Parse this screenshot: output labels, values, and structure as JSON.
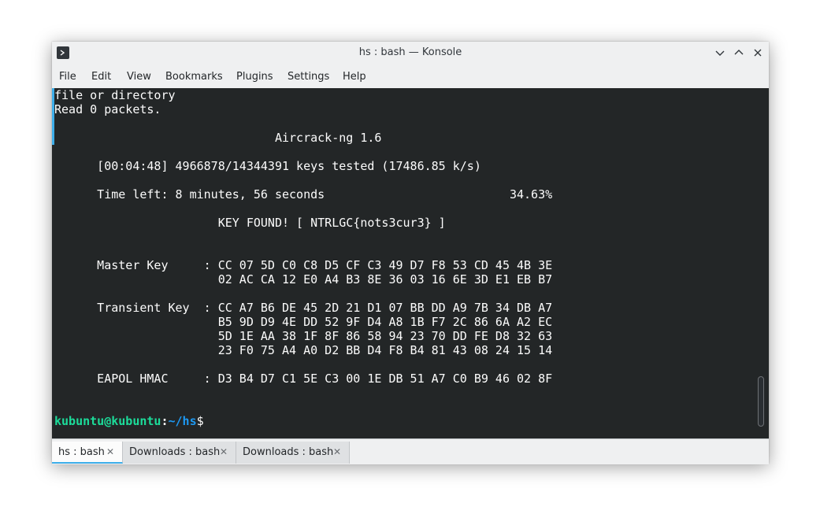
{
  "window": {
    "title": "hs : bash — Konsole"
  },
  "menu": [
    "File",
    "Edit",
    "View",
    "Bookmarks",
    "Plugins",
    "Settings",
    "Help"
  ],
  "terminal": {
    "lines": [
      "file or directory",
      "Read 0 packets.",
      "",
      "                               Aircrack-ng 1.6",
      "",
      "      [00:04:48] 4966878/14344391 keys tested (17486.85 k/s)",
      "",
      "      Time left: 8 minutes, 56 seconds                          34.63%",
      "",
      "                       KEY FOUND! [ NTRLGC{nots3cur3} ]",
      "",
      "",
      "      Master Key     : CC 07 5D C0 C8 D5 CF C3 49 D7 F8 53 CD 45 4B 3E",
      "                       02 AC CA 12 E0 A4 B3 8E 36 03 16 6E 3D E1 EB B7",
      "",
      "      Transient Key  : CC A7 B6 DE 45 2D 21 D1 07 BB DD A9 7B 34 DB A7",
      "                       B5 9D D9 4E DD 52 9F D4 A8 1B F7 2C 86 6A A2 EC",
      "                       5D 1E AA 38 1F 8F 86 58 94 23 70 DD FE D8 32 63",
      "                       23 F0 75 A4 A0 D2 BB D4 F8 B4 81 43 08 24 15 14",
      "",
      "      EAPOL HMAC     : D3 B4 D7 C1 5E C3 00 1E DB 51 A7 C0 B9 46 02 8F"
    ],
    "prompt": {
      "user_host": "kubuntu@kubuntu",
      "colon": ":",
      "path": "~/hs",
      "symbol": "$"
    }
  },
  "tabs": [
    {
      "label": "hs : bash",
      "active": true
    },
    {
      "label": "Downloads : bash",
      "active": false
    },
    {
      "label": "Downloads : bash",
      "active": false
    }
  ],
  "colors": {
    "terminal_bg": "#232627",
    "terminal_fg": "#fcfcfc",
    "prompt_user": "#1cdc9a",
    "prompt_path": "#1d99f3",
    "accent": "#3daee9"
  },
  "icons": {
    "app": "konsole-icon",
    "tab_close": "close-icon"
  }
}
